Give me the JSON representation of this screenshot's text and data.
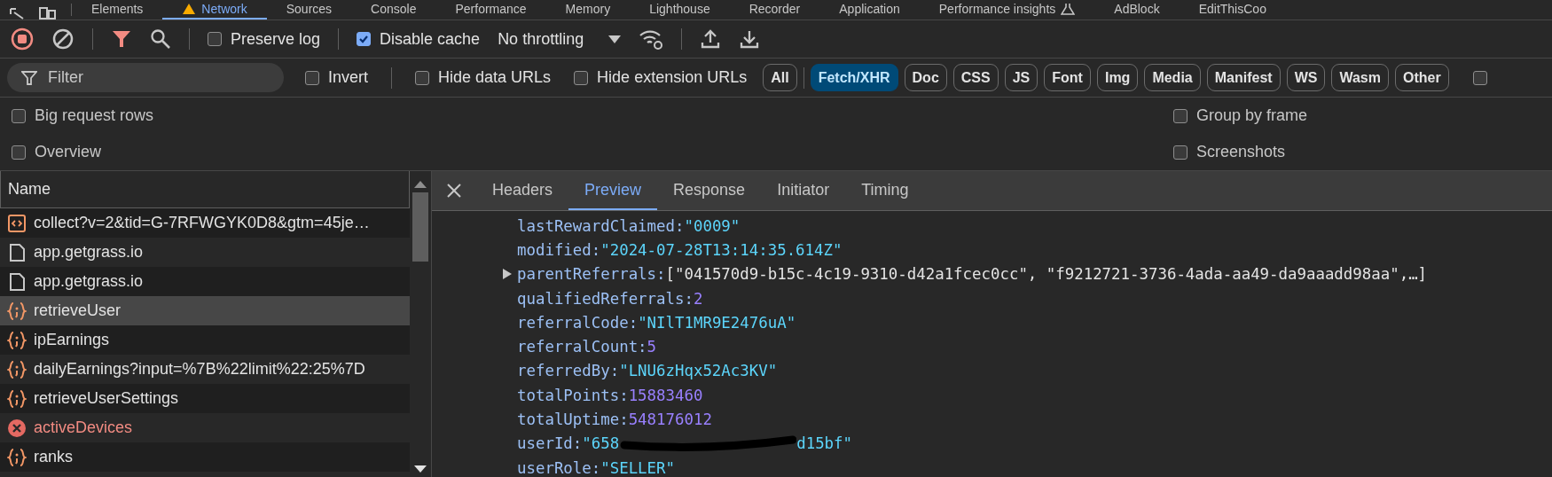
{
  "panel_tabs": [
    {
      "label": "Elements",
      "selected": false,
      "warning": false,
      "experimental": false
    },
    {
      "label": "Network",
      "selected": true,
      "warning": true,
      "experimental": false
    },
    {
      "label": "Sources",
      "selected": false,
      "warning": false,
      "experimental": false
    },
    {
      "label": "Console",
      "selected": false,
      "warning": false,
      "experimental": false
    },
    {
      "label": "Performance",
      "selected": false,
      "warning": false,
      "experimental": false
    },
    {
      "label": "Memory",
      "selected": false,
      "warning": false,
      "experimental": false
    },
    {
      "label": "Lighthouse",
      "selected": false,
      "warning": false,
      "experimental": false
    },
    {
      "label": "Recorder",
      "selected": false,
      "warning": false,
      "experimental": false
    },
    {
      "label": "Application",
      "selected": false,
      "warning": false,
      "experimental": false
    },
    {
      "label": "Performance insights",
      "selected": false,
      "warning": false,
      "experimental": true
    },
    {
      "label": "AdBlock",
      "selected": false,
      "warning": false,
      "experimental": false
    },
    {
      "label": "EditThisCoo",
      "selected": false,
      "warning": false,
      "experimental": false
    }
  ],
  "toolbar": {
    "recording": true,
    "filter_active": true,
    "preserve_log": {
      "label": "Preserve log",
      "checked": false
    },
    "disable_cache": {
      "label": "Disable cache",
      "checked": true
    },
    "throttling": "No throttling"
  },
  "filter_bar": {
    "placeholder": "Filter",
    "checkboxes": [
      {
        "label": "Invert",
        "checked": false
      },
      {
        "label": "Hide data URLs",
        "checked": false
      },
      {
        "label": "Hide extension URLs",
        "checked": false
      }
    ],
    "types": [
      {
        "label": "All",
        "selected": false
      },
      {
        "label": "Fetch/XHR",
        "selected": true
      },
      {
        "label": "Doc",
        "selected": false
      },
      {
        "label": "CSS",
        "selected": false
      },
      {
        "label": "JS",
        "selected": false
      },
      {
        "label": "Font",
        "selected": false
      },
      {
        "label": "Img",
        "selected": false
      },
      {
        "label": "Media",
        "selected": false
      },
      {
        "label": "Manifest",
        "selected": false
      },
      {
        "label": "WS",
        "selected": false
      },
      {
        "label": "Wasm",
        "selected": false
      },
      {
        "label": "Other",
        "selected": false
      }
    ],
    "trailing_checkbox": {
      "checked": false
    }
  },
  "settings": {
    "left": [
      {
        "label": "Big request rows",
        "checked": false
      },
      {
        "label": "Overview",
        "checked": false
      }
    ],
    "right": [
      {
        "label": "Group by frame",
        "checked": false
      },
      {
        "label": "Screenshots",
        "checked": false
      }
    ]
  },
  "requests": {
    "column": "Name",
    "rows": [
      {
        "name": "collect?v=2&tid=G-7RFWGYK0D8&gtm=45je…",
        "kind": "ping",
        "selected": false
      },
      {
        "name": "app.getgrass.io",
        "kind": "document",
        "selected": false
      },
      {
        "name": "app.getgrass.io",
        "kind": "document",
        "selected": false
      },
      {
        "name": "retrieveUser",
        "kind": "fetch",
        "selected": true
      },
      {
        "name": "ipEarnings",
        "kind": "fetch",
        "selected": false
      },
      {
        "name": "dailyEarnings?input=%7B%22limit%22:25%7D",
        "kind": "fetch",
        "selected": false
      },
      {
        "name": "retrieveUserSettings",
        "kind": "fetch",
        "selected": false
      },
      {
        "name": "activeDevices",
        "kind": "error",
        "selected": false
      },
      {
        "name": "ranks",
        "kind": "fetch",
        "selected": false
      }
    ]
  },
  "detail_tabs": [
    {
      "label": "Headers",
      "selected": false
    },
    {
      "label": "Preview",
      "selected": true
    },
    {
      "label": "Response",
      "selected": false
    },
    {
      "label": "Initiator",
      "selected": false
    },
    {
      "label": "Timing",
      "selected": false
    }
  ],
  "preview": [
    {
      "key": "lastRewardClaimed:",
      "kind": "string",
      "value": "\"0009\"",
      "expandable": false
    },
    {
      "key": "modified:",
      "kind": "string",
      "value": "\"2024-07-28T13:14:35.614Z\"",
      "expandable": false
    },
    {
      "key": "parentReferrals:",
      "kind": "array",
      "value": "[\"041570d9-b15c-4c19-9310-d42a1fcec0cc\", \"f9212721-3736-4ada-aa49-da9aaadd98aa\",…]",
      "expandable": true
    },
    {
      "key": "qualifiedReferrals:",
      "kind": "number",
      "value": "2",
      "expandable": false
    },
    {
      "key": "referralCode:",
      "kind": "string",
      "value": "\"NIlT1MR9E2476uA\"",
      "expandable": false
    },
    {
      "key": "referralCount:",
      "kind": "number",
      "value": "5",
      "expandable": false
    },
    {
      "key": "referredBy:",
      "kind": "string",
      "value": "\"LNU6zHqx52Ac3KV\"",
      "expandable": false
    },
    {
      "key": "totalPoints:",
      "kind": "number",
      "value": "15883460",
      "expandable": false
    },
    {
      "key": "totalUptime:",
      "kind": "number",
      "value": "548176012",
      "expandable": false
    },
    {
      "key": "userId:",
      "kind": "redacted",
      "value_start": "\"658",
      "value_end": "d15bf\"",
      "expandable": false
    },
    {
      "key": "userRole:",
      "kind": "string",
      "value": "\"SELLER\"",
      "expandable": false
    }
  ]
}
